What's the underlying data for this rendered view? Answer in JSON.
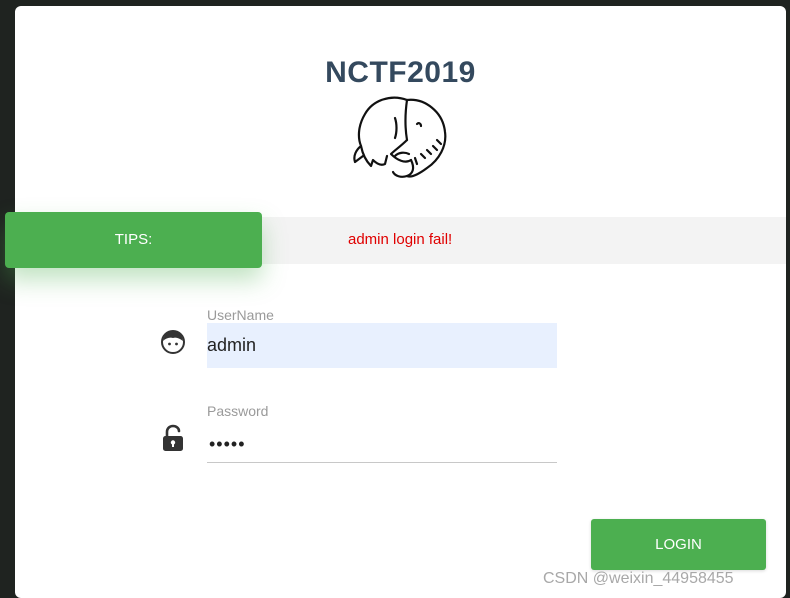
{
  "header": {
    "title": "NCTF2019",
    "logo_icon": "elephant-icon"
  },
  "tips": {
    "label": "TIPS:",
    "message": "admin login fail!",
    "label_color": "#4caf50",
    "message_color": "#e00000"
  },
  "form": {
    "username": {
      "label": "UserName",
      "value": "admin",
      "icon": "user-face-icon"
    },
    "password": {
      "label": "Password",
      "value": "•••••",
      "icon": "unlock-icon"
    },
    "login_label": "LOGIN"
  },
  "watermark": "CSDN @weixin_44958455",
  "colors": {
    "accent": "#4caf50",
    "title": "#34495e",
    "input_autofill_bg": "#e8f0fe"
  }
}
